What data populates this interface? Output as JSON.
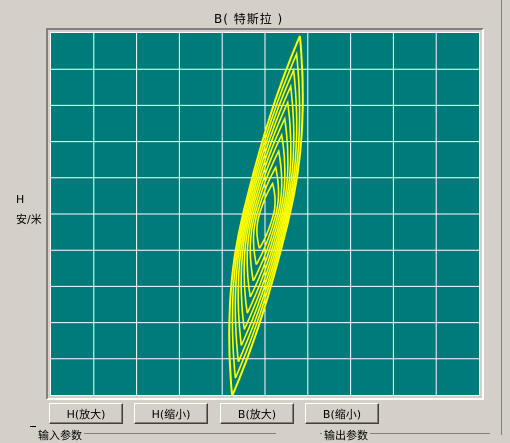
{
  "title": "B( 特斯拉 )",
  "y_axis": {
    "line1": "H",
    "line2": "安/米"
  },
  "buttons": [
    {
      "label": "H(放大)"
    },
    {
      "label": "H(缩小)"
    },
    {
      "label": "B(放大)"
    },
    {
      "label": "B(缩小)"
    }
  ],
  "groups": {
    "input": "输入参数",
    "output": "输出参数"
  },
  "colors": {
    "plot_bg": "#007b7b",
    "grid": "#ffffff",
    "curve": "#ffff00",
    "panel": "#d4d0c8"
  },
  "grid": {
    "columns": 10,
    "rows": 10
  },
  "chart_data": {
    "type": "line",
    "description_loops": "nested hysteresis loops",
    "loops": [
      {
        "amplitude": 1.0
      },
      {
        "amplitude": 0.9
      },
      {
        "amplitude": 0.81
      },
      {
        "amplitude": 0.72
      },
      {
        "amplitude": 0.63
      },
      {
        "amplitude": 0.54
      },
      {
        "amplitude": 0.45
      },
      {
        "amplitude": 0.36
      },
      {
        "amplitude": 0.27
      },
      {
        "amplitude": 0.18
      }
    ]
  }
}
